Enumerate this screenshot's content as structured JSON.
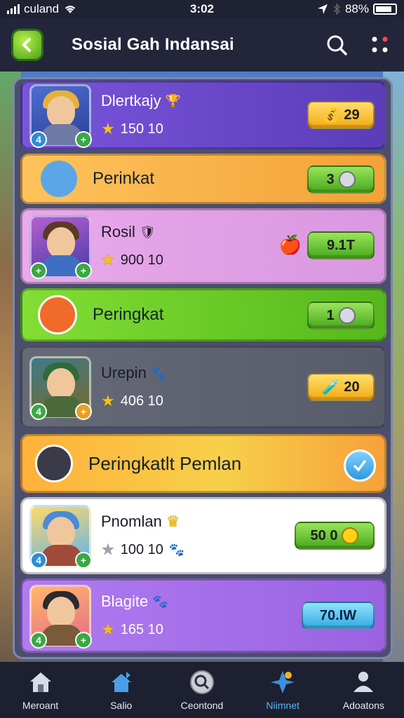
{
  "status_bar": {
    "carrier": "culand",
    "time": "3:02",
    "battery": "88%"
  },
  "header": {
    "title": "Sosial Gah Indansai"
  },
  "rows": [
    {
      "name": "Dlertkajy",
      "score": "150 10",
      "reward": "29",
      "type": "player"
    },
    {
      "banner": "Perinkat",
      "reward": "3"
    },
    {
      "name": "Rosil",
      "score": "900 10",
      "reward": "9.1T",
      "type": "player"
    },
    {
      "banner": "Peringkat",
      "reward": "1"
    },
    {
      "name": "Urepin",
      "score": "406 10",
      "reward": "20",
      "type": "player"
    },
    {
      "banner": "Peringkatlt Pemlan"
    },
    {
      "name": "Pnomlan",
      "score": "100 10",
      "reward": "50 0",
      "type": "player"
    },
    {
      "name": "Blagite",
      "score": "165 10",
      "reward": "70.IW",
      "type": "player"
    }
  ],
  "nav": [
    {
      "label": "Meroant",
      "icon": "home-icon"
    },
    {
      "label": "Salio",
      "icon": "house-flag-icon"
    },
    {
      "label": "Ceontond",
      "icon": "search-disc-icon"
    },
    {
      "label": "Niimnet",
      "icon": "star-compass-icon"
    },
    {
      "label": "Adoatons",
      "icon": "profile-icon"
    }
  ],
  "colors": {
    "row_purple": "#6b4bd1",
    "row_orange": "#f6b54f",
    "row_pink": "#e4a6e6",
    "row_green": "#6fcf2c",
    "row_gray": "#5d616f",
    "row_white": "#ffffff",
    "row_violet": "#a06ee8",
    "accent_blue": "#5fb4f0"
  }
}
